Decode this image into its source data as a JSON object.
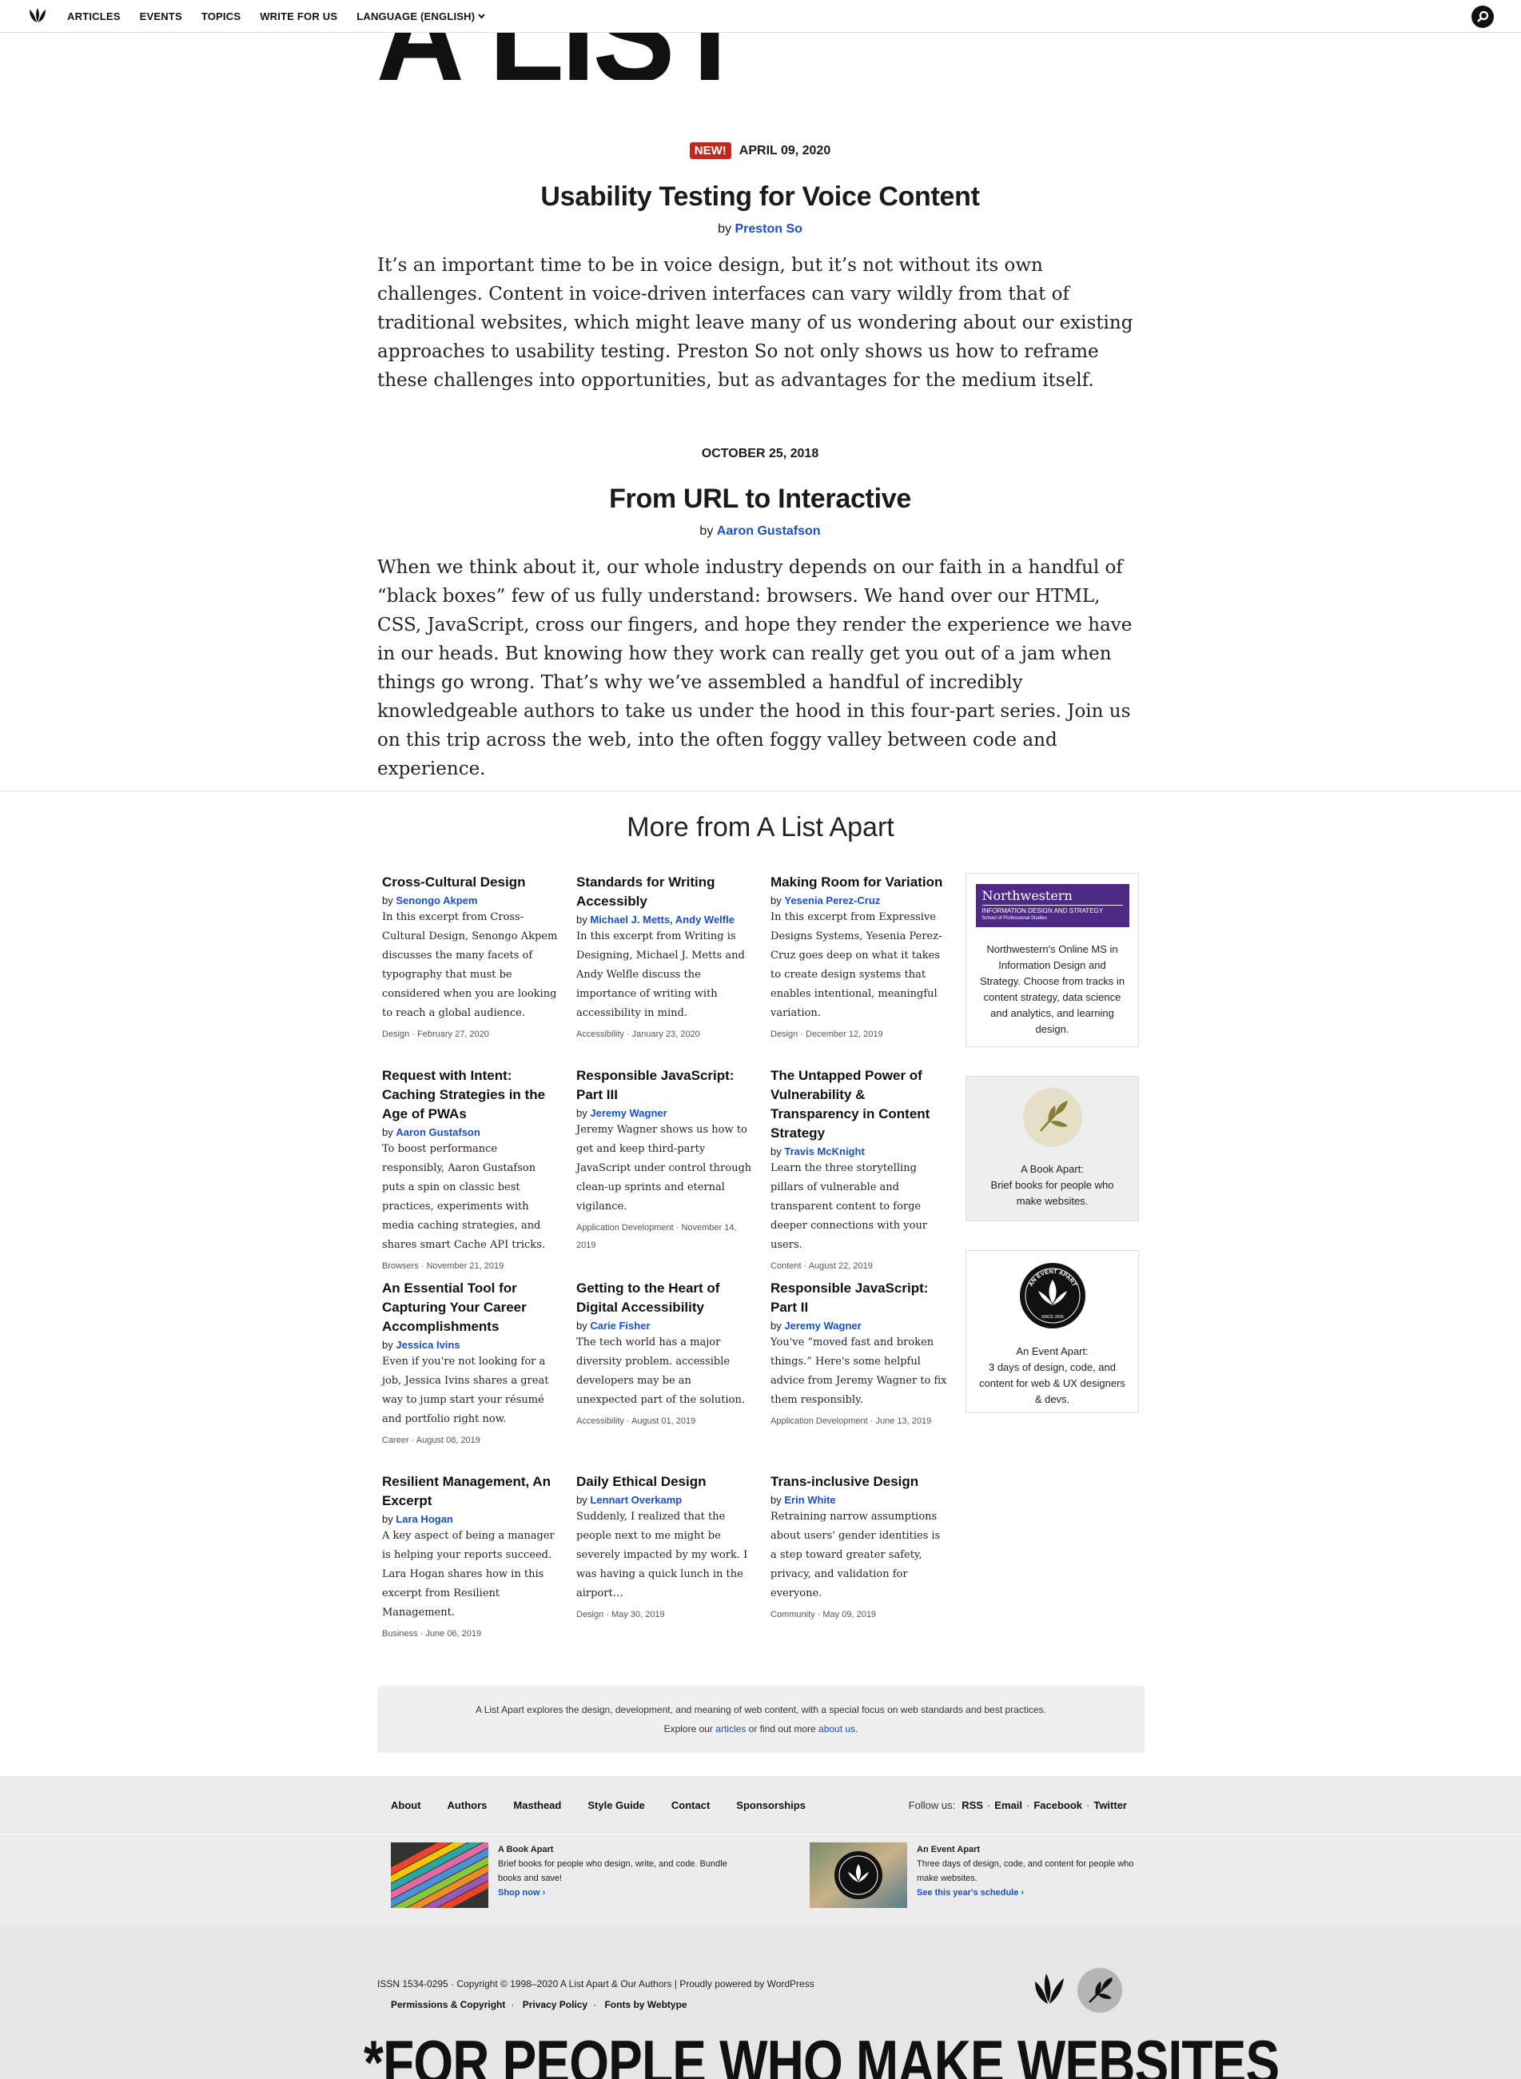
{
  "nav": {
    "items": [
      "ARTICLES",
      "EVENTS",
      "TOPICS",
      "WRITE FOR US",
      "LANGUAGE (ENGLISH)"
    ],
    "logo_icon": "ala-leaves-icon",
    "search_icon": "search-icon"
  },
  "masthead": {
    "title": "A LIST APART"
  },
  "featured": [
    {
      "badge": "NEW!",
      "date": "APRIL 09, 2020",
      "title": "Usability Testing for Voice Content",
      "by": "by",
      "author": "Preston So",
      "summary": "It’s an important time to be in voice design, but it’s not without its own challenges. Content in voice-driven interfaces can vary wildly from that of traditional websites, which might leave many of us wondering about our existing approaches to usability testing. Preston So not only shows us how to reframe these challenges into opportunities, but as advantages for the medium itself."
    },
    {
      "date": "OCTOBER 25, 2018",
      "title": "From URL to Interactive",
      "by": "by",
      "author": "Aaron Gustafson",
      "summary": "When we think about it, our whole industry depends on our faith in a handful of “black boxes” few of us fully understand: browsers. We hand over our HTML, CSS, JavaScript, cross our fingers, and hope they render the experience we have in our heads. But knowing how they work can really get you out of a jam when things go wrong. That’s why we’ve assembled a handful of incredibly knowledgeable authors to take us under the hood in this four-part series. Join us on this trip across the web, into the often foggy valley between code and experience."
    }
  ],
  "more": {
    "title": "More from A List Apart",
    "articles": [
      {
        "title": "Cross-Cultural Design",
        "author": "Senongo Akpem",
        "desc": "In this excerpt from Cross-Cultural Design, Senongo Akpem discusses the many facets of typography that must be considered when you are looking to reach a global audience.",
        "meta": "Design · February 27, 2020"
      },
      {
        "title": "Standards for Writing Accessibly",
        "author": "Michael J. Metts, Andy Welfle",
        "desc": "In this excerpt from Writing is Designing, Michael J. Metts and Andy Welfle discuss the importance of writing with accessibility in mind.",
        "meta": "Accessibility · January 23, 2020"
      },
      {
        "title": "Making Room for Variation",
        "author": "Yesenia Perez-Cruz",
        "desc": "In this excerpt from Expressive Designs Systems, Yesenia Perez-Cruz goes deep on what it takes to create design systems that enables intentional, meaningful variation.",
        "meta": "Design · December 12, 2019"
      },
      {
        "title": "Request with Intent: Caching Strategies in the Age of PWAs",
        "author": "Aaron Gustafson",
        "desc": "To boost performance responsibly, Aaron Gustafson puts a spin on classic best practices, experiments with media caching strategies, and shares smart Cache API tricks.",
        "meta": "Browsers · November 21, 2019"
      },
      {
        "title": "Responsible JavaScript: Part III",
        "author": "Jeremy Wagner",
        "desc": "Jeremy Wagner shows us how to get and keep third-party JavaScript under control through clean-up sprints and eternal vigilance.",
        "meta": "Application Development · November 14, 2019"
      },
      {
        "title": "The Untapped Power of Vulnerability & Transparency in Content Strategy",
        "author": "Travis McKnight",
        "desc": "Learn the three storytelling pillars of vulnerable and transparent content to forge deeper connections with your users.",
        "meta": "Content · August 22, 2019"
      },
      {
        "title": "An Essential Tool for Capturing Your Career Accomplishments",
        "author": "Jessica Ivins",
        "desc": "Even if you're not looking for a job, Jessica Ivins shares a great way to jump start your résumé and portfolio right now.",
        "meta": "Career · August 08, 2019"
      },
      {
        "title": "Getting to the Heart of Digital Accessibility",
        "author": "Carie Fisher",
        "desc": "The tech world has a major diversity problem. accessible developers may be an unexpected part of the solution.",
        "meta": "Accessibility · August 01, 2019"
      },
      {
        "title": "Responsible JavaScript: Part II",
        "author": "Jeremy Wagner",
        "desc": "You've “moved fast and broken things.” Here's some helpful advice from Jeremy Wagner to fix them responsibly.",
        "meta": "Application Development · June 13, 2019"
      },
      {
        "title": "Resilient Management, An Excerpt",
        "author": "Lara Hogan",
        "desc": "A key aspect of being a manager is helping your reports succeed. Lara Hogan shares how in this excerpt from Resilient Management.",
        "meta": "Business · June 06, 2019"
      },
      {
        "title": "Daily Ethical Design",
        "author": "Lennart Overkamp",
        "desc": "Suddenly, I realized that the people next to me might be severely impacted by my work. I was having a quick lunch in the airport…",
        "meta": "Design · May 30, 2019"
      },
      {
        "title": "Trans-inclusive Design",
        "author": "Erin White",
        "desc": "Retraining narrow assumptions about users' gender identities is a step toward greater safety, privacy, and validation for everyone.",
        "meta": "Community · May 09, 2019"
      }
    ]
  },
  "sidebar": {
    "northwestern": {
      "logo_name": "Northwestern",
      "logo_sub": "INFORMATION DESIGN AND STRATEGY",
      "logo_sub2": "School of Professional Studies",
      "text": "Northwestern's Online MS in Information Design and Strategy. Choose from tracks in content strategy, data science and analytics, and learning design."
    },
    "book": {
      "title": "A Book Apart:",
      "text": "Brief books for people who make websites."
    },
    "event": {
      "title": "An Event Apart:",
      "text": "3 days of design, code, and content for web & UX designers & devs.",
      "badge_text": "AN EVENT APART",
      "badge_since": "SINCE 2005"
    }
  },
  "about": {
    "line1": "A List Apart explores the design, development, and meaning of web content, with a special focus on web standards and best practices.",
    "line2_pre": "Explore our",
    "articles_link": "articles",
    "line2_mid": "or find out more",
    "about_link": "about us",
    "line2_end": "."
  },
  "footer": {
    "links": [
      "About",
      "Authors",
      "Masthead",
      "Style Guide",
      "Contact",
      "Sponsorships"
    ],
    "follow_label": "Follow us:",
    "follow": [
      "RSS",
      "Email",
      "Facebook",
      "Twitter"
    ],
    "promo_book": {
      "title": "A Book Apart",
      "text": "Brief books for people who design, write, and code. Bundle books and save!",
      "link": "Shop now ›"
    },
    "promo_event": {
      "title": "An Event Apart",
      "text": "Three days of design, code, and content for people who make websites.",
      "link": "See this year's schedule ›"
    },
    "copyright": "ISSN 1534-0295 · Copyright © 1998–2020 A List Apart & Our Authors | Proudly powered by WordPress",
    "legal": [
      "Permissions & Copyright",
      "Privacy Policy",
      "Fonts by Webtype"
    ],
    "tagline": "*FOR PEOPLE WHO MAKE WEBSITES"
  },
  "colors": {
    "accent": "#1a4fbf",
    "badge": "#c0291e",
    "northwestern": "#4e2a84"
  }
}
